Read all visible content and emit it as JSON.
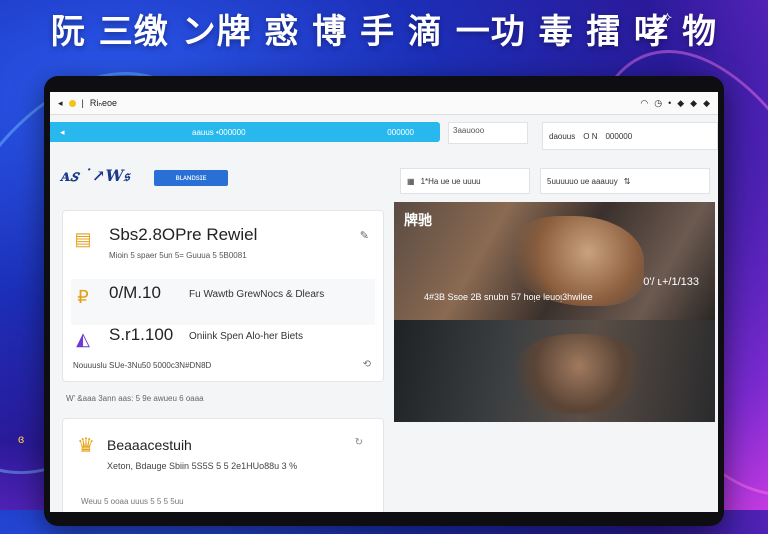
{
  "banner": {
    "headline": "阮 三缴 ン牌 惑 博 手 滴 一功 毒 擂 哮 物",
    "icon": "sparkle-icon"
  },
  "titlebar": {
    "app_name": "Riₙeoe",
    "right_icons": [
      "wifi-icon",
      "clock-icon",
      "dot-icon",
      "diamond-icon",
      "diamond-icon",
      "diamond-icon"
    ]
  },
  "tabbar": {
    "arrow": "◂",
    "tab_left": "aauus •000000",
    "tab_right": "000000"
  },
  "top_small_box": "3aauooo",
  "top_right_box": {
    "left": "daouus",
    "mid": "O  N",
    "right": "000000"
  },
  "logo": {
    "text": "ᴀ𝑠 ˙↗W𝔰",
    "chip": "ʙʟᴀɴᴅsɪᴇ"
  },
  "list_card": {
    "items": [
      {
        "icon": "document-icon",
        "title": "Sbs2.8OPre Rewiel",
        "subtitle": "Mioin  5 spaer  5un 5= Guuua  5 5B0081",
        "action": "edit-icon"
      },
      {
        "icon": "coin-icon",
        "title": "0/M.10",
        "desc": "Fu  Wawtb GrewNocs & Dlears"
      },
      {
        "icon": "chart-icon",
        "title": "S.r1.100",
        "desc": "Oniink  Spen  Alo-her Biets",
        "footer": "Nouuuslu  SUe-3Nu50 5000c3N#DN8D",
        "footer_icon": "link-icon"
      }
    ]
  },
  "middle_line": "W' &aaa 3ann aas: 5 9e awueu   6 oaaa",
  "bottom_card": {
    "icon": "trophy-icon",
    "title": "Beaaacestuih",
    "subtitle": "Xeton, Bdauge Sbiin 5S5S 5 5 2e1HUo88u 3 %",
    "top_right": "↻",
    "bottom": "Weuu 5 ooaa  uuus 5 5 5 5uu"
  },
  "search_left": {
    "icon": "calendar-icon",
    "text": "1*Ha ue ue uuuu"
  },
  "search_right": {
    "text": "5uuuuuo ue aaauuy",
    "icon": "sort-icon"
  },
  "media": {
    "title": "牌驰",
    "time": "0'/ ʟ+/1/133",
    "caption": "4#3B Ssoe   2B  snubn 57 hoᴉe  leuoᴉ3hwilee"
  }
}
